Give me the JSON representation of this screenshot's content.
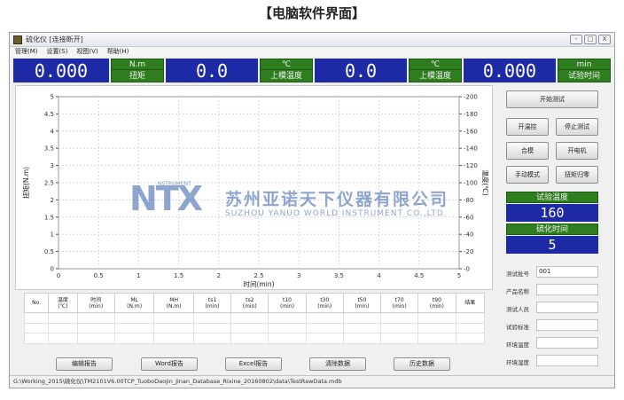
{
  "heading": "【电脑软件界面】",
  "window": {
    "title": "硫化仪 [连接断开]",
    "buttons": [
      "-",
      "□",
      "X"
    ]
  },
  "menu": [
    "管理(M)",
    "设置(S)",
    "视图(V)",
    "帮助(H)"
  ],
  "readouts": [
    {
      "value": "0.000",
      "unit": "N.m",
      "label": "扭矩"
    },
    {
      "value": "0.0",
      "unit": "℃",
      "label": "上模温度"
    },
    {
      "value": "0.0",
      "unit": "℃",
      "label": "上模温度"
    },
    {
      "value": "0.000",
      "unit": "min",
      "label": "试验时间"
    }
  ],
  "chart_data": {
    "type": "line",
    "xlabel": "时间(min)",
    "ylabel": "扭矩(N.m)",
    "y2label": "温度(℃)",
    "xlim": [
      0,
      5
    ],
    "ylim": [
      0,
      5
    ],
    "y2lim": [
      0,
      200
    ],
    "x_ticks": [
      "0",
      "0.5",
      "1",
      "1.5",
      "2",
      "2.5",
      "3",
      "3.5",
      "4",
      "4.5",
      "5"
    ],
    "y_ticks": [
      "0",
      "0.5",
      "1",
      "1.5",
      "2",
      "2.5",
      "3",
      "3.5",
      "4",
      "4.5",
      "5"
    ],
    "y2_ticks": [
      "0",
      "20",
      "40",
      "60",
      "80",
      "100",
      "120",
      "140",
      "160",
      "180",
      "200"
    ],
    "series": [],
    "grid": true
  },
  "table": {
    "headers": [
      "No.",
      "温度\n(℃)",
      "时间\n(min)",
      "ML\n(N.m)",
      "MH\n(N.m)",
      "ts1\n(min)",
      "ts2\n(min)",
      "t10\n(min)",
      "t30\n(min)",
      "t50\n(min)",
      "t70\n(min)",
      "t90\n(min)",
      "结果"
    ]
  },
  "bottom_buttons": [
    "编辑报告",
    "Word报告",
    "Excel报告",
    "清除数据",
    "历史数据"
  ],
  "side": {
    "buttons": [
      "开始测试",
      "开温控",
      "停止测试",
      "合模",
      "开电机",
      "手动模式",
      "扭矩归零"
    ],
    "params": [
      {
        "label": "试验温度",
        "value": "160"
      },
      {
        "label": "硫化时间",
        "value": "5"
      }
    ],
    "info": [
      {
        "label": "测试批号",
        "value": "001"
      },
      {
        "label": "产品名称",
        "value": ""
      },
      {
        "label": "测试人员",
        "value": ""
      },
      {
        "label": "试验标准",
        "value": ""
      },
      {
        "label": "环境温度",
        "value": ""
      },
      {
        "label": "环境湿度",
        "value": ""
      }
    ]
  },
  "status_path": "G:\\Working_2015\\硫化仪\\TM2101V6.00TCP_TuoboDaojin_Jinan_Database_Rixine_20160802\\data\\TestRawData.mdb",
  "watermark": {
    "logo": "NTX",
    "logo_small": "NSTRUMENT",
    "cn": "苏州亚诺天下仪器有限公司",
    "en": "SUZHOU YANUO WORLD INSTRUMENT CO.,LTD."
  },
  "colors": {
    "readout_bg": "#1e2aa5",
    "label_bg": "#2e7d1f"
  }
}
